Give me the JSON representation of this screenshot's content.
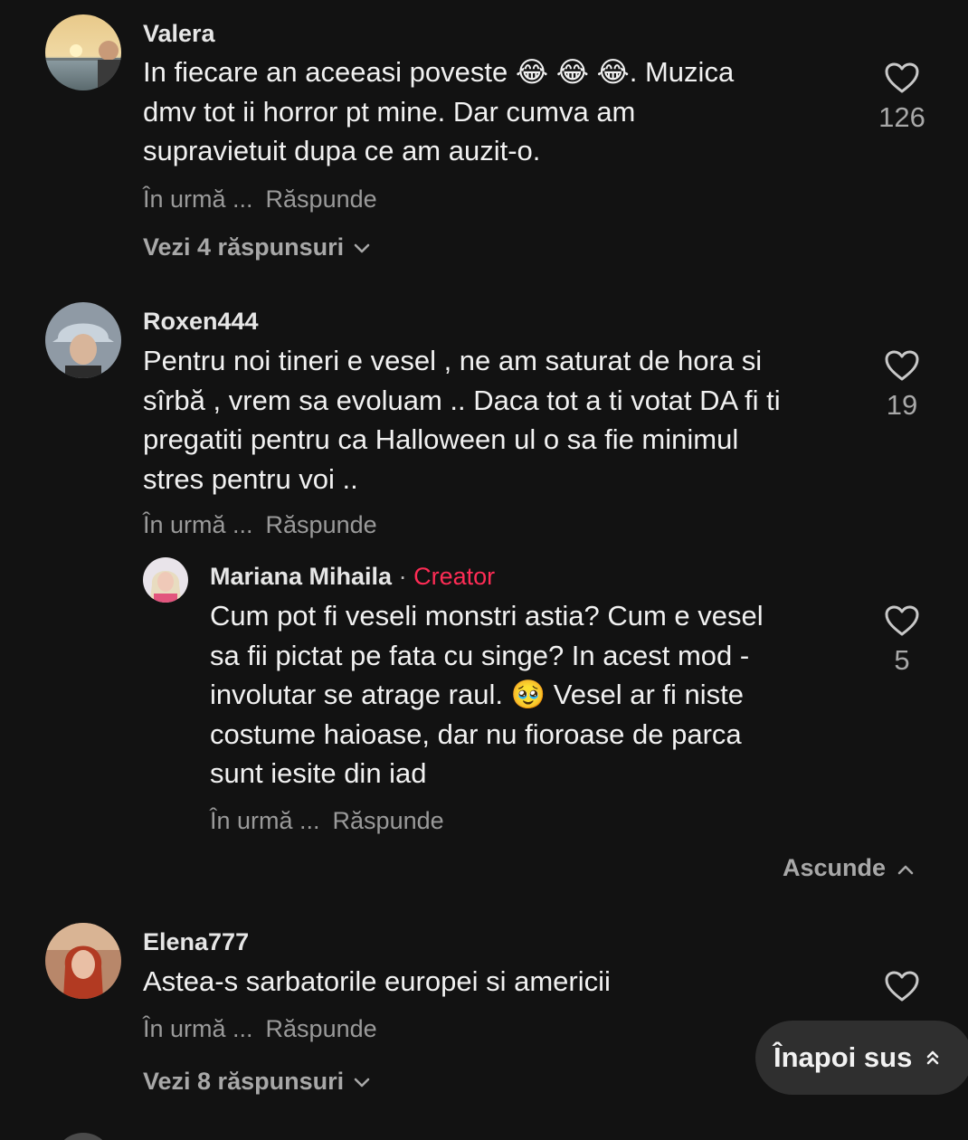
{
  "comments": [
    {
      "username": "Valera",
      "text_lines": [
        "In fiecare an aceeasi poveste 😂 😂 😂. Muzica",
        "dmv tot ii horror pt mine. Dar cumva am",
        "supravietuit dupa ce am auzit-o."
      ],
      "time": "În urmă ...",
      "reply_label": "Răspunde",
      "likes": "126",
      "view_replies": "Vezi 4 răspunsuri"
    },
    {
      "username": "Roxen444",
      "text_lines": [
        "Pentru noi tineri e vesel , ne am saturat de hora si",
        "sîrbă , vrem sa evoluam .. Daca tot a ti votat DA fi ti",
        "pregatiti pentru ca Halloween ul o sa fie minimul",
        "stres pentru voi .."
      ],
      "time": "În urmă ...",
      "reply_label": "Răspunde",
      "likes": "19",
      "reply": {
        "username": "Mariana Mihaila",
        "separator": "·",
        "badge": "Creator",
        "text_lines": [
          "Cum pot fi veseli monstri astia? Cum e vesel",
          "sa fii pictat pe fata cu singe? In acest mod -",
          "involutar se atrage raul. 🥹 Vesel ar fi niste",
          "costume haioase, dar nu fioroase de parca",
          "sunt iesite din iad"
        ],
        "time": "În urmă ...",
        "reply_label": "Răspunde",
        "likes": "5"
      },
      "hide_label": "Ascunde"
    },
    {
      "username": "Elena777",
      "text_lines": [
        "Astea-s sarbatorile europei si americii"
      ],
      "time": "În urmă ...",
      "reply_label": "Răspunde",
      "likes": "",
      "view_replies": "Vezi 8 răspunsuri"
    }
  ],
  "back_to_top": "Înapoi sus",
  "colors": {
    "background": "#121212",
    "creator_badge": "#fe2c55",
    "muted_text": "#9a9a9a"
  }
}
